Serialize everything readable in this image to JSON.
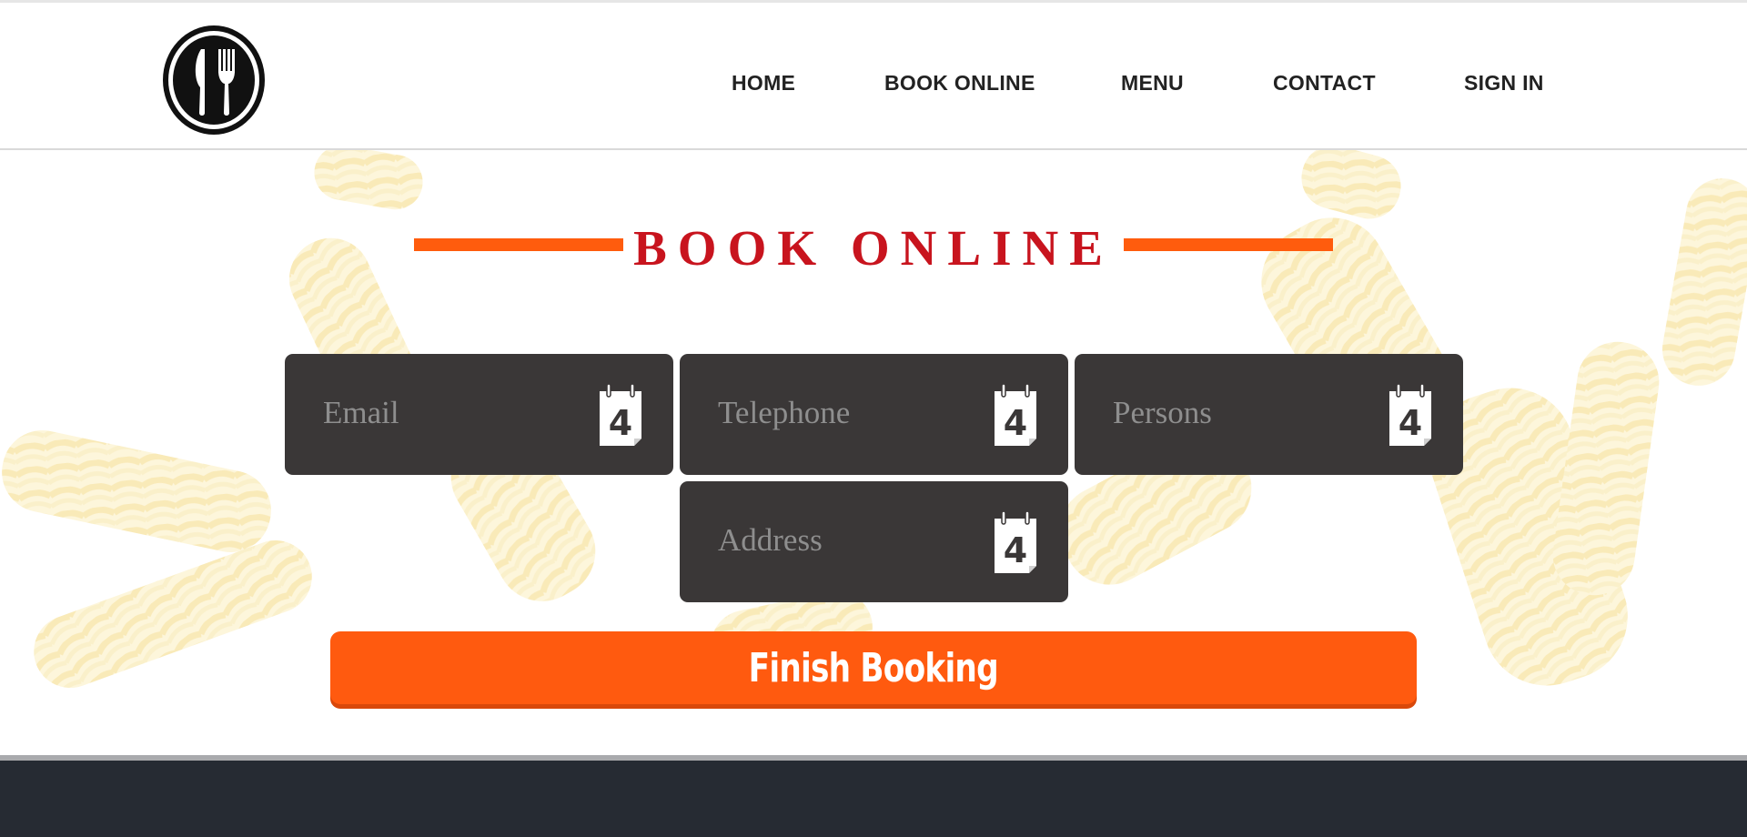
{
  "brand": {
    "logo_icon": "knife-fork-icon"
  },
  "nav": {
    "items": [
      {
        "label": "HOME"
      },
      {
        "label": "BOOK ONLINE"
      },
      {
        "label": "MENU"
      },
      {
        "label": "CONTACT"
      },
      {
        "label": "SIGN IN"
      }
    ]
  },
  "page": {
    "title": "BOOK ONLINE"
  },
  "form": {
    "fields": [
      {
        "placeholder": "Email",
        "icon": "calendar-icon",
        "icon_text": "4"
      },
      {
        "placeholder": "Telephone",
        "icon": "calendar-icon",
        "icon_text": "4"
      },
      {
        "placeholder": "Persons",
        "icon": "calendar-icon",
        "icon_text": "4"
      },
      {
        "placeholder": "Address",
        "icon": "calendar-icon",
        "icon_text": "4"
      }
    ],
    "submit_label": "Finish Booking"
  },
  "colors": {
    "accent": "#ff5a0f",
    "title": "#c8141e",
    "field_bg": "#3a3737",
    "footer_bg": "#262b33"
  }
}
